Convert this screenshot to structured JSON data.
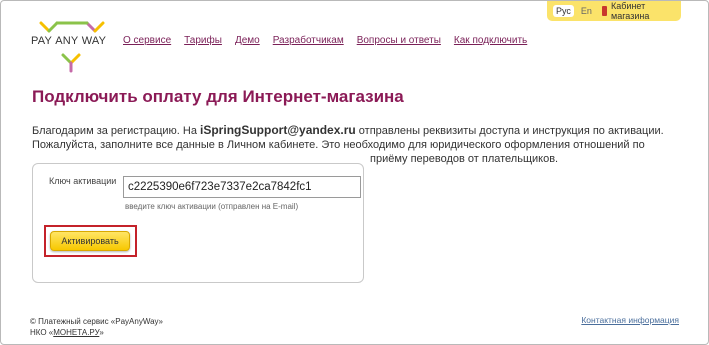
{
  "header": {
    "lang_ru": "Рус",
    "lang_en": "En",
    "cabinet_link": "Кабинет магазина"
  },
  "logo": {
    "words": [
      "PAY",
      "ANY",
      "WAY"
    ],
    "colors": [
      "#f6c000",
      "#8bc34a",
      "#c56aa8"
    ]
  },
  "nav": {
    "items": [
      {
        "label": "О сервисе"
      },
      {
        "label": "Тарифы"
      },
      {
        "label": "Демо"
      },
      {
        "label": "Разработчикам"
      },
      {
        "label": "Вопросы и ответы"
      },
      {
        "label": "Как подключить"
      }
    ]
  },
  "main": {
    "title": "Подключить оплату для Интернет-магазина",
    "intro_part1": "Благодарим за регистрацию. На ",
    "email": "iSpringSupport@yandex.ru",
    "intro_part2": " отправлены реквизиты доступа и инструкция по активации. Пожалуйста, заполните все данные в Личном кабинете. Это необходимо для юридического оформления отношений по",
    "intro_part3": "приёму переводов от плательщиков."
  },
  "activation": {
    "key_label": "Ключ активации",
    "key_value": "c2225390e6f723e7337e2ca7842fc1",
    "hint": "введите ключ активации (отправлен на E-mail)",
    "button_label": "Активировать"
  },
  "footer": {
    "copyright": "© Платежный сервис «PayAnyWay»",
    "nko_prefix": "НКО «",
    "nko_link": "МОНЕТА.РУ",
    "nko_suffix": "»",
    "contact_link": "Контактная информация"
  },
  "colors": {
    "title": "#8b1a56",
    "nav_link": "#7a1f57",
    "accent_yellow": "#fbe36a",
    "highlight_red": "#c4222a"
  }
}
